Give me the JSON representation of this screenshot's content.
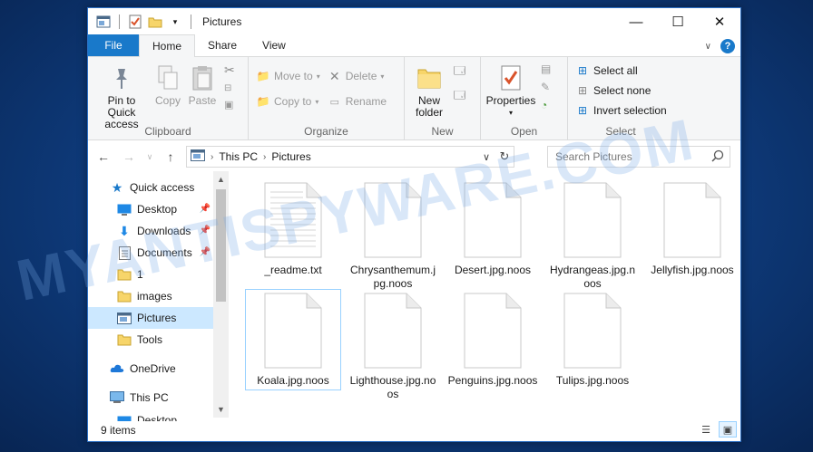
{
  "window": {
    "title": "Pictures",
    "controls": {
      "minimize": "—",
      "maximize": "☐",
      "close": "✕"
    }
  },
  "tabs": [
    {
      "label": "File"
    },
    {
      "label": "Home"
    },
    {
      "label": "Share"
    },
    {
      "label": "View"
    }
  ],
  "ribbon": {
    "clipboard": {
      "pin_label": "Pin to Quick access",
      "copy_label": "Copy",
      "paste_label": "Paste",
      "group_label": "Clipboard"
    },
    "organize": {
      "move_to": "Move to",
      "copy_to": "Copy to",
      "delete": "Delete",
      "rename": "Rename",
      "group_label": "Organize"
    },
    "new": {
      "new_folder": "New folder",
      "group_label": "New"
    },
    "open": {
      "properties": "Properties",
      "group_label": "Open"
    },
    "select": {
      "select_all": "Select all",
      "select_none": "Select none",
      "invert_selection": "Invert selection",
      "group_label": "Select"
    }
  },
  "address": {
    "crumbs": [
      "This PC",
      "Pictures"
    ],
    "search_placeholder": "Search Pictures"
  },
  "nav": {
    "quick_access": "Quick access",
    "items": [
      "Desktop",
      "Downloads",
      "Documents",
      "1",
      "images",
      "Pictures",
      "Tools"
    ],
    "onedrive": "OneDrive",
    "this_pc": "This PC",
    "partial": "Desktop"
  },
  "files": [
    {
      "name": "_readme.txt"
    },
    {
      "name": "Chrysanthemum.jpg.noos"
    },
    {
      "name": "Desert.jpg.noos"
    },
    {
      "name": "Hydrangeas.jpg.noos"
    },
    {
      "name": "Jellyfish.jpg.noos"
    },
    {
      "name": "Koala.jpg.noos"
    },
    {
      "name": "Lighthouse.jpg.noos"
    },
    {
      "name": "Penguins.jpg.noos"
    },
    {
      "name": "Tulips.jpg.noos"
    }
  ],
  "status": {
    "item_count": "9 items"
  },
  "watermark": "MYANTISPYWARE.COM",
  "colors": {
    "accent": "#1979ca",
    "selection": "#cce8ff",
    "folder": "#f7d56a"
  }
}
